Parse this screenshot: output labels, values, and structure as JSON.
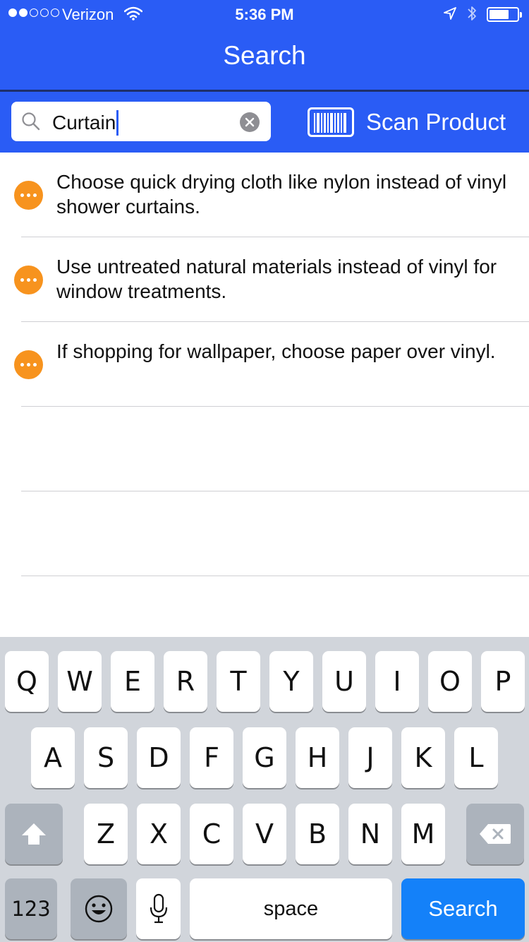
{
  "status_bar": {
    "carrier": "Verizon",
    "time": "5:36 PM",
    "signal_bars_filled": 2,
    "signal_bars_total": 5,
    "battery_level": 0.7,
    "icons": [
      "wifi-icon",
      "location-arrow-icon",
      "bluetooth-icon",
      "battery-icon"
    ]
  },
  "nav": {
    "title": "Search"
  },
  "search": {
    "value": "Curtain",
    "scan_label": "Scan Product",
    "icons": [
      "search-icon",
      "clear-icon",
      "barcode-icon"
    ]
  },
  "results": [
    {
      "text": "Choose quick drying cloth like nylon instead of vinyl shower curtains."
    },
    {
      "text": "Use untreated natural materials instead of vinyl for window treatments."
    },
    {
      "text": "If shopping for wallpaper, choose paper over vinyl."
    }
  ],
  "keyboard": {
    "row1": [
      "Q",
      "W",
      "E",
      "R",
      "T",
      "Y",
      "U",
      "I",
      "O",
      "P"
    ],
    "row2": [
      "A",
      "S",
      "D",
      "F",
      "G",
      "H",
      "J",
      "K",
      "L"
    ],
    "row3": [
      "Z",
      "X",
      "C",
      "V",
      "B",
      "N",
      "M"
    ],
    "numbers_key": "123",
    "space_key": "space",
    "return_key": "Search"
  },
  "colors": {
    "header": "#2a5cf5",
    "accent_orange": "#f7931e",
    "return_key": "#1481f9"
  }
}
